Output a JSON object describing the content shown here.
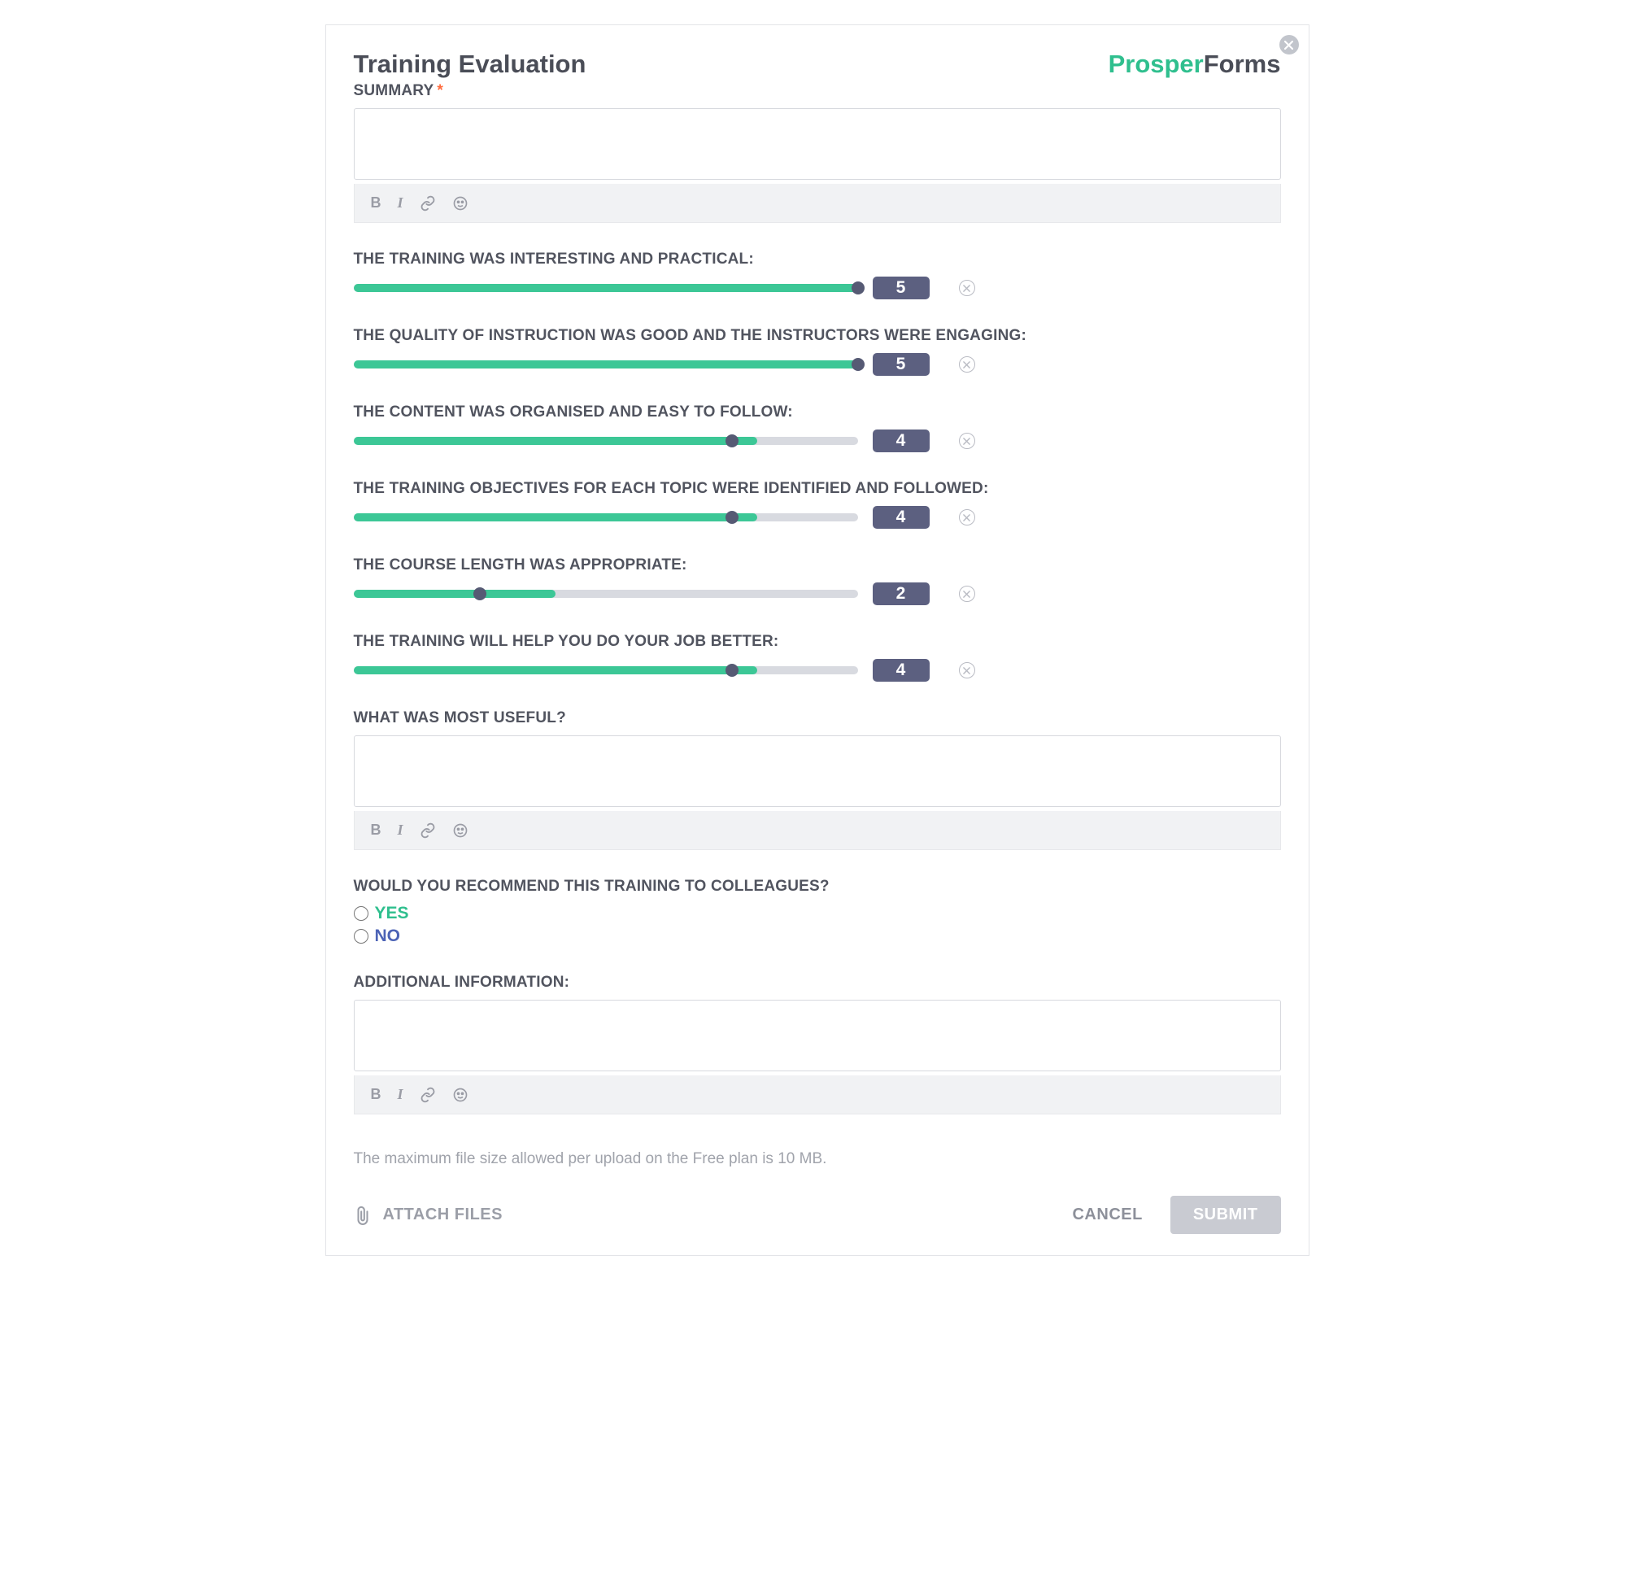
{
  "header": {
    "title": "Training Evaluation",
    "logo_part1": "Prosper",
    "logo_part2": "Forms"
  },
  "fields": {
    "summary": {
      "label": "SUMMARY",
      "required": true
    },
    "useful": {
      "label": "WHAT WAS MOST USEFUL?"
    },
    "additional": {
      "label": "ADDITIONAL INFORMATION:"
    },
    "recommend": {
      "label": "WOULD YOU RECOMMEND THIS TRAINING TO COLLEAGUES?",
      "yes": "YES",
      "no": "NO"
    }
  },
  "sliders": [
    {
      "label": "THE TRAINING WAS INTERESTING AND PRACTICAL:",
      "value": 5,
      "max": 5
    },
    {
      "label": "THE QUALITY OF INSTRUCTION WAS GOOD AND THE INSTRUCTORS WERE ENGAGING:",
      "value": 5,
      "max": 5
    },
    {
      "label": "THE CONTENT WAS ORGANISED AND EASY TO FOLLOW:",
      "value": 4,
      "max": 5
    },
    {
      "label": "THE TRAINING OBJECTIVES FOR EACH TOPIC WERE IDENTIFIED AND FOLLOWED:",
      "value": 4,
      "max": 5
    },
    {
      "label": "THE COURSE LENGTH WAS APPROPRIATE:",
      "value": 2,
      "max": 5
    },
    {
      "label": "THE TRAINING WILL HELP YOU DO YOUR JOB BETTER:",
      "value": 4,
      "max": 5
    }
  ],
  "upload": {
    "note": "The maximum file size allowed per upload on the Free plan is 10 MB.",
    "attach_label": "ATTACH FILES"
  },
  "actions": {
    "cancel": "CANCEL",
    "submit": "SUBMIT"
  },
  "colors": {
    "accent": "#2fbf8e",
    "slider_fill": "#3cc796",
    "badge": "#5c6080"
  }
}
